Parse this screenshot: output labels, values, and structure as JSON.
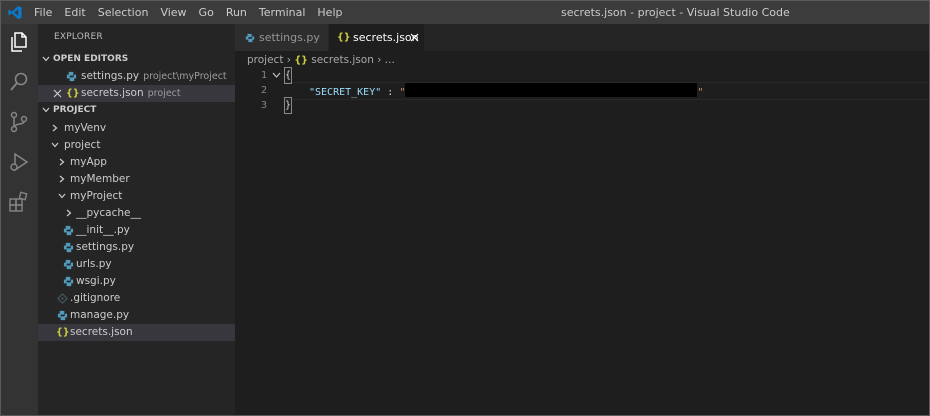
{
  "titlebar": {
    "menus": [
      "File",
      "Edit",
      "Selection",
      "View",
      "Go",
      "Run",
      "Terminal",
      "Help"
    ],
    "title": "secrets.json - project - Visual Studio Code"
  },
  "activity_bar": [
    "explorer-icon",
    "search-icon",
    "source-control-icon",
    "run-debug-icon",
    "extensions-icon"
  ],
  "sidebar": {
    "title": "EXPLORER",
    "open_editors": {
      "header": "OPEN EDITORS",
      "items": [
        {
          "name": "settings.py",
          "desc": "project\\myProject",
          "icon": "python-file-icon"
        },
        {
          "name": "secrets.json",
          "desc": "project",
          "icon": "json-file-icon"
        }
      ]
    },
    "project": {
      "header": "PROJECT",
      "tree": [
        {
          "name": "myVenv",
          "type": "folder",
          "expanded": false
        },
        {
          "name": "project",
          "type": "folder",
          "expanded": true
        },
        {
          "name": "myApp",
          "type": "folder",
          "expanded": false
        },
        {
          "name": "myMember",
          "type": "folder",
          "expanded": false
        },
        {
          "name": "myProject",
          "type": "folder",
          "expanded": true
        },
        {
          "name": "__pycache__",
          "type": "folder",
          "expanded": false
        },
        {
          "name": "__init__.py",
          "type": "python"
        },
        {
          "name": "settings.py",
          "type": "python"
        },
        {
          "name": "urls.py",
          "type": "python"
        },
        {
          "name": "wsgi.py",
          "type": "python"
        },
        {
          "name": ".gitignore",
          "type": "git"
        },
        {
          "name": "manage.py",
          "type": "python"
        },
        {
          "name": "secrets.json",
          "type": "json",
          "selected": true
        }
      ]
    }
  },
  "tabs": [
    {
      "label": "settings.py",
      "active": false
    },
    {
      "label": "secrets.json",
      "active": true
    }
  ],
  "breadcrumb": [
    "project",
    "secrets.json",
    "..."
  ],
  "editor": {
    "line_numbers": [
      "1",
      "2",
      "3"
    ],
    "lines": [
      "{",
      "\"SECRET_KEY\" : \"",
      "\"",
      "}"
    ],
    "key": "\"SECRET_KEY\"",
    "sep": " : ",
    "str_open": "\"",
    "str_close": "\"",
    "open_brace": "{",
    "close_brace": "}"
  },
  "colors": {
    "accent_blue": "#0a7acc",
    "json_braces": "#cbcb41",
    "python_icon": "#519aba",
    "key_color": "#9cdcfe",
    "string_color": "#ce9178"
  }
}
